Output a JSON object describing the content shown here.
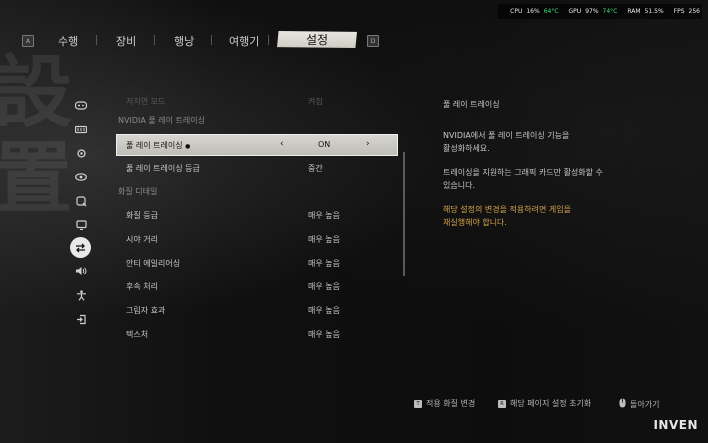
{
  "stats": {
    "cpu_label": "CPU",
    "cpu_pct": "16%",
    "cpu_temp": "64°C",
    "gpu_label": "GPU",
    "gpu_pct": "97%",
    "gpu_temp": "74°C",
    "ram_label": "RAM",
    "ram_pct": "51.5%",
    "fps_label": "FPS",
    "fps_value": "256"
  },
  "topnav": {
    "left_key": "A",
    "right_key": "D",
    "tabs": [
      "수행",
      "장비",
      "행낭",
      "여행기",
      "설정"
    ],
    "active_tab": "설정"
  },
  "sidebar": {
    "icons": [
      "gamepad-icon",
      "controller-icon",
      "gear-icon",
      "eye-icon",
      "magnifier-icon",
      "monitor-icon",
      "swap-icon",
      "speaker-icon",
      "accessibility-icon",
      "exit-icon"
    ],
    "active": "swap-icon"
  },
  "settings": {
    "faded_row": {
      "label": "저지연 모드",
      "value": "켜짐"
    },
    "section_rt": "NVIDIA 풀 레이 트레이싱",
    "rows_rt": [
      {
        "label": "풀 레이 트레이싱",
        "value": "ON",
        "selected": true
      },
      {
        "label": "풀 레이 트레이싱 등급",
        "value": "중간"
      }
    ],
    "section_quality": "화질 디테일",
    "rows_quality": [
      {
        "label": "화질 등급",
        "value": "매우 높음"
      },
      {
        "label": "시야 거리",
        "value": "매우 높음"
      },
      {
        "label": "안티 에일리어싱",
        "value": "매우 높음"
      },
      {
        "label": "후속 처리",
        "value": "매우 높음"
      },
      {
        "label": "그림자 효과",
        "value": "매우 높음"
      },
      {
        "label": "텍스처",
        "value": "매우 높음"
      }
    ]
  },
  "description": {
    "title": "풀 레이 트레이싱",
    "p1_line1": "NVIDIA에서 풀 레이 트레이싱 기능을",
    "p1_line2": "활성화하세요.",
    "p2_line1": "트레이싱을 지원하는 그래픽 카드만 활성화할 수",
    "p2_line2": "있습니다.",
    "warn_line1": "해당 설정의 변경을 적용하려면 게임을",
    "warn_line2": "재실행해야 합니다."
  },
  "hints": {
    "apply_key": "T",
    "apply_label": "적용 화질 변경",
    "reset_key": "R",
    "reset_label": "해당 페이지 설정 초기화",
    "back_label": "돌아가기"
  },
  "logo": "INVEN",
  "colors": {
    "accent_warn": "#d4a34a",
    "stat_green": "#3fe07a",
    "selected_bg": "#d8d6d0"
  }
}
